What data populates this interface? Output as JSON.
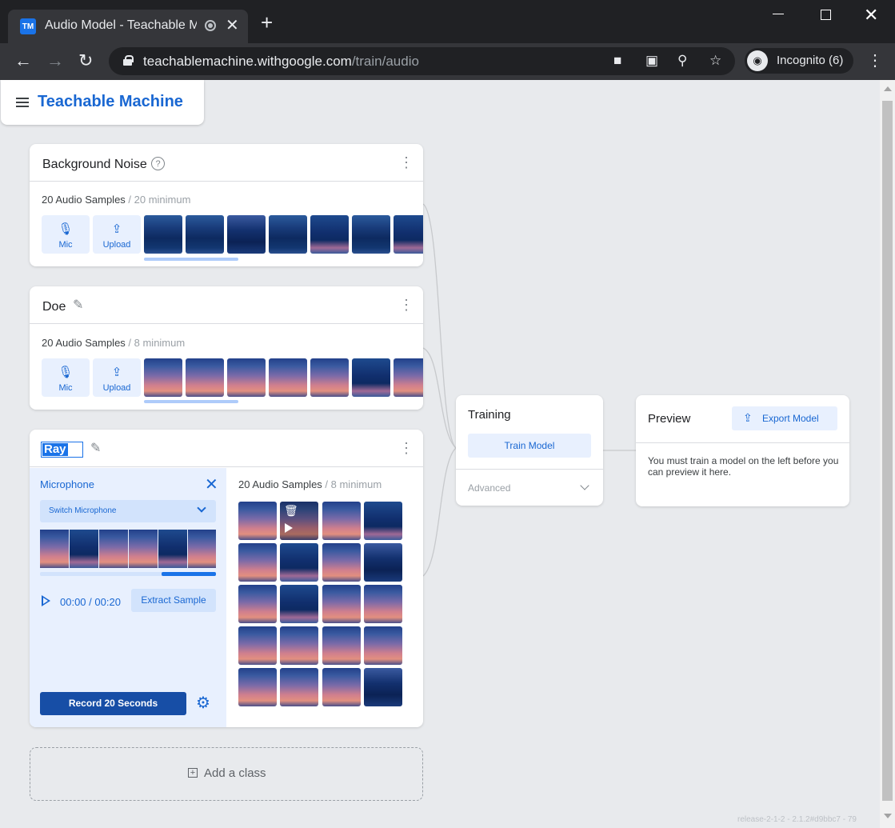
{
  "browser": {
    "tab_title": "Audio Model - Teachable Machine",
    "favicon_text": "TM",
    "url_domain": "teachablemachine.withgoogle.com",
    "url_path": "/train/audio",
    "incognito_label": "Incognito (6)"
  },
  "app": {
    "title": "Teachable Machine"
  },
  "classes": [
    {
      "name": "Background Noise",
      "samples_count": "20 Audio Samples",
      "samples_min": " / 20 minimum",
      "mic_label": "Mic",
      "upload_label": "Upload"
    },
    {
      "name": "Doe",
      "samples_count": "20 Audio Samples",
      "samples_min": " / 8 minimum",
      "mic_label": "Mic",
      "upload_label": "Upload"
    },
    {
      "name": "Ray",
      "samples_count": "20 Audio Samples",
      "samples_min": " / 8 minimum"
    }
  ],
  "recorder": {
    "title": "Microphone",
    "switch_label": "Switch Microphone",
    "time_current": "00:00",
    "time_separator": " / ",
    "time_total": "00:20",
    "extract_label": "Extract Sample",
    "record_label": "Record 20 Seconds",
    "progress": 0.31
  },
  "add_class_label": "Add a class",
  "training": {
    "title": "Training",
    "train_button": "Train Model",
    "advanced_label": "Advanced"
  },
  "preview": {
    "title": "Preview",
    "export_button": "Export Model",
    "message": "You must train a model on the left before you can preview it here."
  },
  "version": "release-2-1-2 - 2.1.2#d9bbc7 - 79"
}
